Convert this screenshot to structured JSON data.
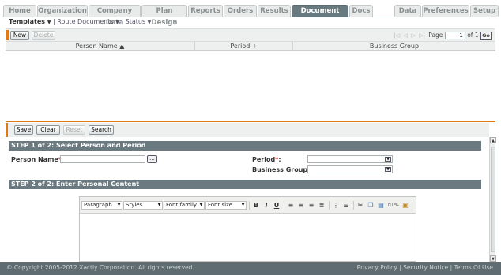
{
  "tabs": [
    {
      "label": "Home",
      "active": false
    },
    {
      "label": "Organization",
      "active": false
    },
    {
      "label": "Company Data",
      "active": false
    },
    {
      "label": "Plan Design",
      "active": false
    },
    {
      "label": "Reports",
      "active": false
    },
    {
      "label": "Orders",
      "active": false
    },
    {
      "label": "Results",
      "active": false
    },
    {
      "label": "Document Mgmt",
      "active": true
    },
    {
      "label": "Docs",
      "active": false
    },
    {
      "label": "Data",
      "active": false
    },
    {
      "label": "Preferences",
      "active": false
    },
    {
      "label": "Setup",
      "active": false
    }
  ],
  "submenu": {
    "templates": "Templates",
    "route_documents": "Route Documents",
    "status": "Status",
    "separator": "|"
  },
  "toolbar": {
    "new_label": "New",
    "delete_label": "Delete",
    "pager": {
      "page_label": "Page",
      "page_value": "1",
      "of_label": "of 1",
      "go_label": "Go"
    }
  },
  "grid": {
    "columns": [
      {
        "label": "Person Name ▲"
      },
      {
        "label": "Period ÷"
      },
      {
        "label": "Business Group"
      }
    ],
    "rows": []
  },
  "form_toolbar": {
    "save_label": "Save",
    "clear_label": "Clear",
    "reset_label": "Reset",
    "search_label": "Search"
  },
  "step1": {
    "title": "STEP 1 of 2: Select Person and Period",
    "person_name_label": "Person Name",
    "person_name_value": "",
    "ellipsis_label": "...",
    "period_label": "Period",
    "period_value": "",
    "business_group_label": "Business Group",
    "business_group_value": "",
    "required_mark": "*",
    "colon": ":"
  },
  "step2": {
    "title": "STEP 2 of 2: Enter Personal Content"
  },
  "editor": {
    "format_select": "Paragraph",
    "styles_select": "Styles",
    "font_family_select": "Font family",
    "font_size_select": "Font size",
    "bold": "B",
    "italic": "I",
    "underline": "U",
    "html_label": "HTML"
  },
  "footer": {
    "copyright": "© Copyright 2005-2012 Xactly Corporation. All rights reserved.",
    "privacy": "Privacy Policy",
    "security": "Security Notice",
    "terms": "Terms Of Use",
    "separator": "|"
  },
  "colors": {
    "accent_orange": "#e07b14",
    "section_bar": "#6b7a80",
    "active_tab": "#68797f",
    "footer_bg": "#5f6d73"
  }
}
